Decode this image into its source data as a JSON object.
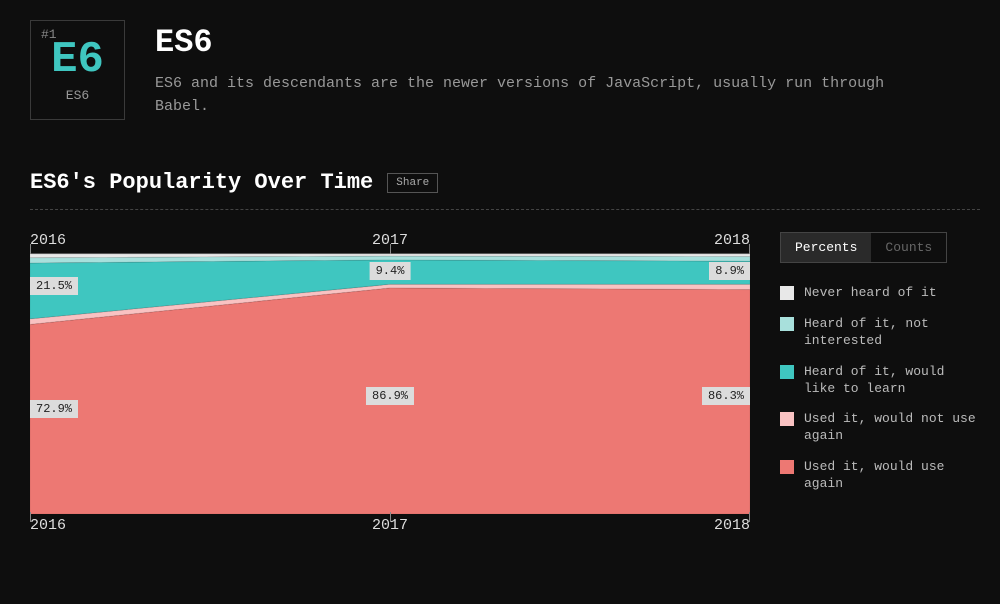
{
  "badge": {
    "rank": "#1",
    "code": "E6",
    "label": "ES6"
  },
  "title": "ES6",
  "description": "ES6 and its descendants are the newer versions of JavaScript, usually run through Babel.",
  "section_title": "ES6's Popularity Over Time",
  "share_label": "Share",
  "toggle": {
    "percents": "Percents",
    "counts": "Counts"
  },
  "legend": {
    "never_heard": "Never heard of it",
    "heard_not_interested": "Heard of it, not interested",
    "heard_learn": "Heard of it, would like to learn",
    "used_not_again": "Used it, would not use again",
    "used_again": "Used it, would use again"
  },
  "colors": {
    "never_heard": "#e8e8e8",
    "heard_not_interested": "#a8e0dc",
    "heard_learn": "#3fc6c0",
    "used_not_again": "#f9c2c2",
    "used_again": "#ed7873"
  },
  "chart_data": {
    "type": "area",
    "title": "ES6's Popularity Over Time",
    "xlabel": "",
    "ylabel": "",
    "ylim": [
      0,
      100
    ],
    "categories": [
      "2016",
      "2017",
      "2018"
    ],
    "series": [
      {
        "name": "Never heard of it",
        "values": [
          1.5,
          0.8,
          1.0
        ]
      },
      {
        "name": "Heard of it, not interested",
        "values": [
          2.0,
          1.5,
          1.8
        ]
      },
      {
        "name": "Heard of it, would like to learn",
        "values": [
          21.5,
          9.4,
          8.9
        ]
      },
      {
        "name": "Used it, would not use again",
        "values": [
          2.1,
          1.4,
          2.0
        ]
      },
      {
        "name": "Used it, would use again",
        "values": [
          72.9,
          86.9,
          86.3
        ]
      }
    ],
    "visible_labels": {
      "heard_learn": [
        "21.5%",
        "9.4%",
        "8.9%"
      ],
      "used_again": [
        "72.9%",
        "86.9%",
        "86.3%"
      ]
    }
  }
}
